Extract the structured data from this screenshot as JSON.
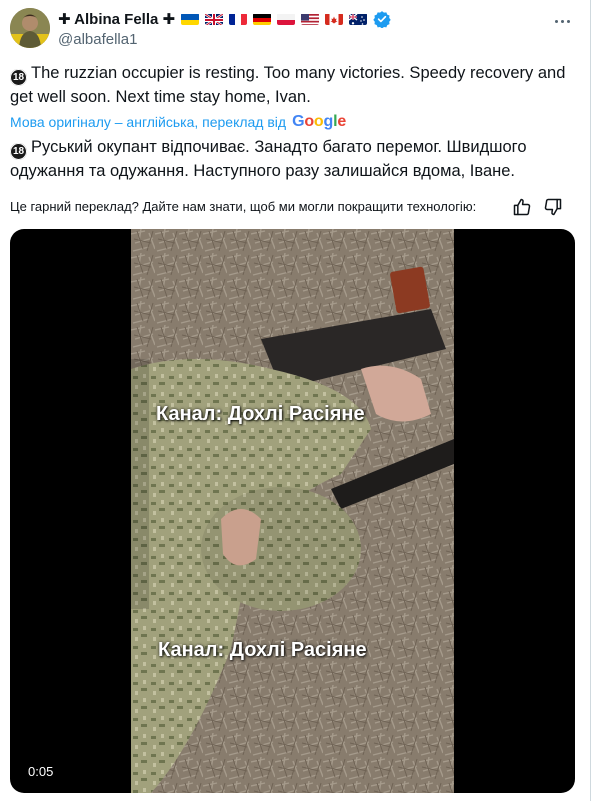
{
  "author": {
    "display_name": "✚ Albina Fella ✚",
    "handle": "@albafella1",
    "flags": [
      "Ukraine",
      "United Kingdom",
      "France",
      "Germany",
      "Poland",
      "United States",
      "Canada",
      "Australia"
    ],
    "verified": true
  },
  "tweet": {
    "age_badge": "18",
    "original_text": "The ruzzian occupier is resting. Too many victories. Speedy recovery and get well soon. Next time stay home, Ivan.",
    "translation_notice": "Мова оригіналу – англійська, переклад від",
    "translation_provider": "Google",
    "translated_text": "Руський окупант відпочиває. Занадто багато перемог. Швидшого одужання та одужання. Наступного разу залишайся вдома, Іване.",
    "feedback_prompt": "Це гарний переклад? Дайте нам знати, щоб ми могли покращити технологію:"
  },
  "video": {
    "watermark_top": "Канал: Дохлі Расіяне",
    "watermark_bottom": "Канал: Дохлі Расіяне",
    "timestamp": "0:05"
  },
  "colors": {
    "link_blue": "#1d9bf0",
    "secondary_text": "#536471",
    "verified_blue": "#1d9bf0"
  },
  "icons": [
    "more-options-icon",
    "verified-badge-icon",
    "thumbs-up-icon",
    "thumbs-down-icon"
  ]
}
